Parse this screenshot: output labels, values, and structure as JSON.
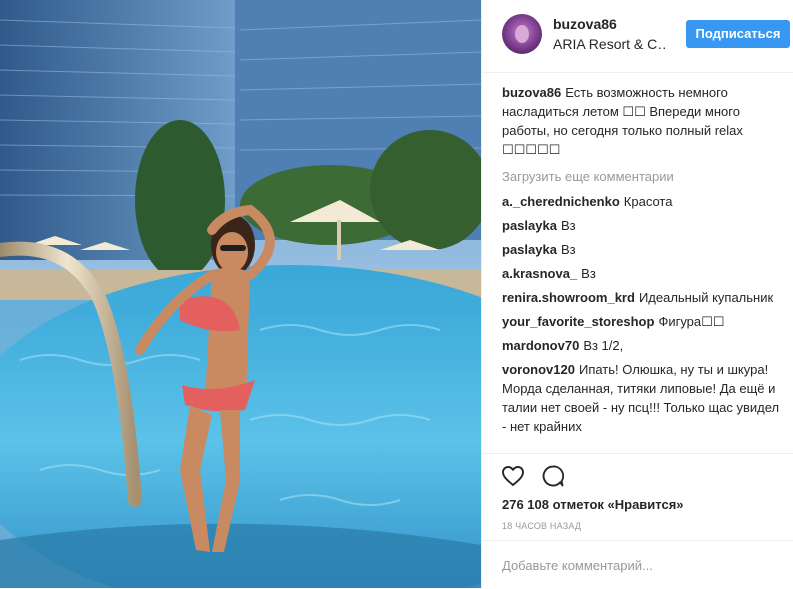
{
  "post": {
    "username": "buzova86",
    "location": "ARIA Resort & C…",
    "follow_label": "Подписаться"
  },
  "caption": {
    "user": "buzova86",
    "text": "Есть возможность немного насладиться летом ☐☐ Впереди много работы, но сегодня только полный relax ☐☐☐☐☐"
  },
  "load_more": "Загрузить еще комментарии",
  "comments": [
    {
      "user": "a._cherednichenko",
      "text": "Красота"
    },
    {
      "user": "paslayka",
      "text": "Вз"
    },
    {
      "user": "paslayka",
      "text": "Вз"
    },
    {
      "user": "a.krasnova_",
      "text": "Вз"
    },
    {
      "user": "renira.showroom_krd",
      "text": "Идеальный купальник"
    },
    {
      "user": "your_favorite_storeshop",
      "text": "Фигура☐☐"
    },
    {
      "user": "mardonov70",
      "text": "Вз 1/2,"
    },
    {
      "user": "voronov120",
      "text": "Ипать! Олюшка, ну ты и шкура! Морда сделанная, титяки липовые! Да ещё и талии нет своей - ну псц!!! Только щас увидел - нет крайних"
    }
  ],
  "likes": "276 108 отметок «Нравится»",
  "timestamp": "18 ЧАСОВ НАЗАД",
  "add_comment_placeholder": "Добавьте комментарий...",
  "icons": {
    "like": "heart-icon",
    "comment": "speech-bubble-icon"
  },
  "colors": {
    "follow_button": "#3897f0",
    "secondary_text": "#999999",
    "primary_text": "#262626",
    "border": "#efefef"
  }
}
